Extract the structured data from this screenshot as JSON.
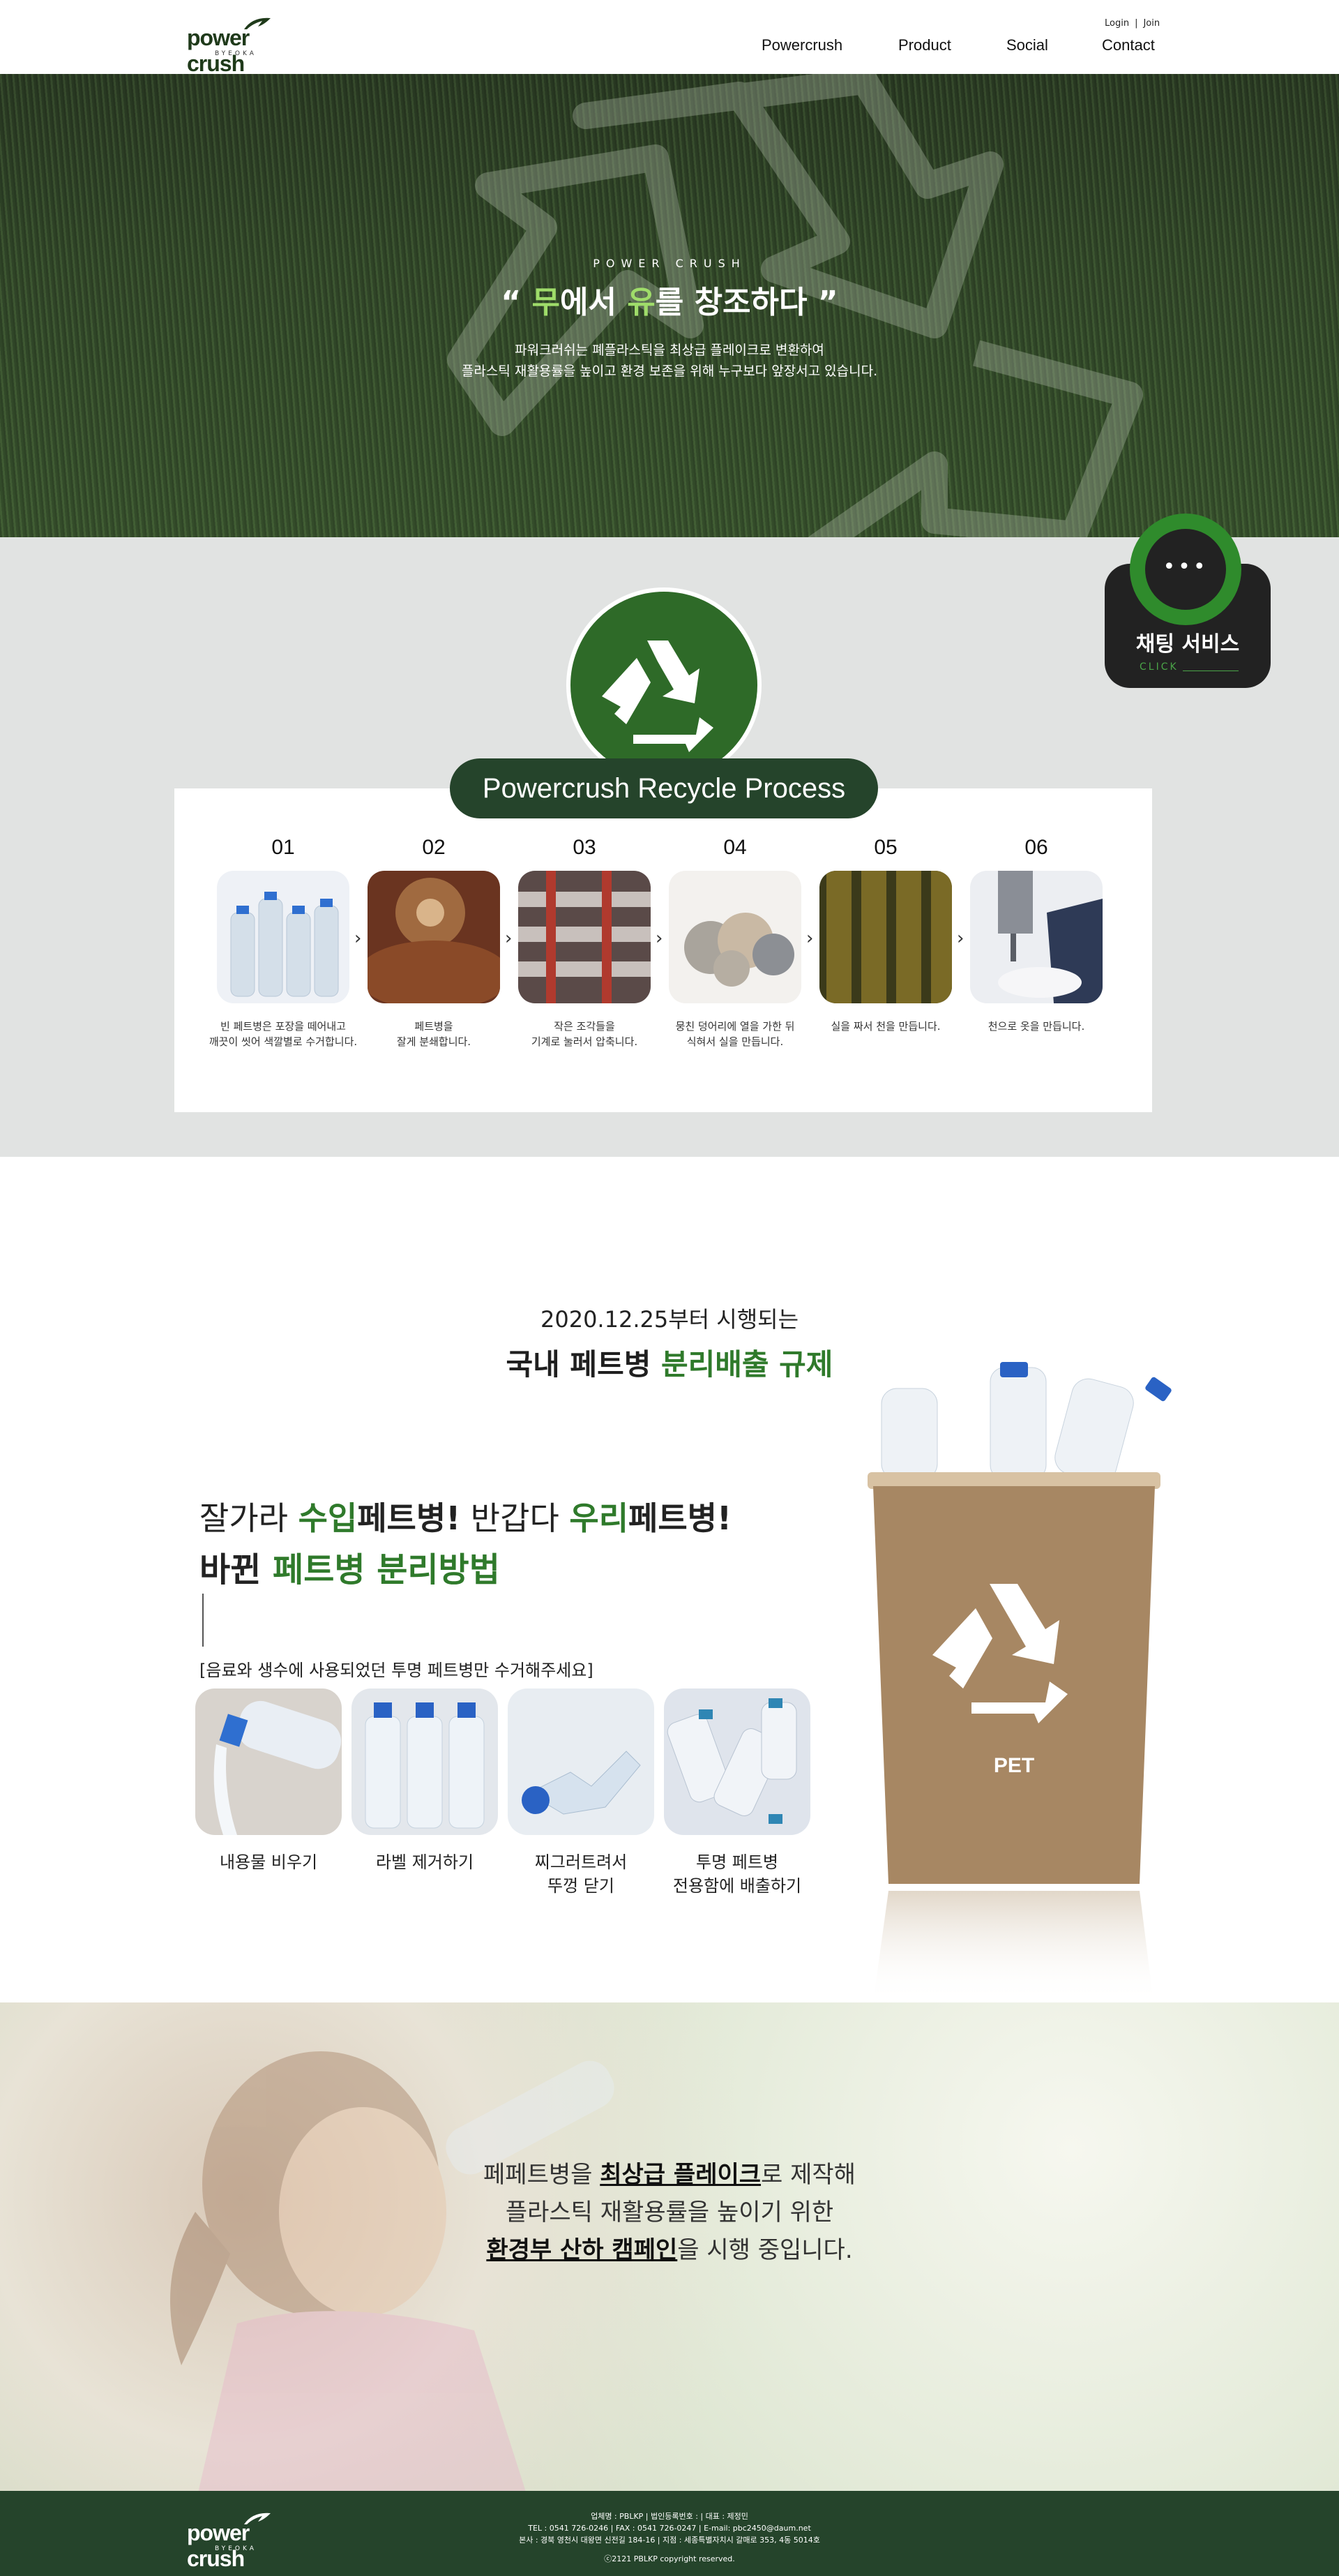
{
  "header": {
    "logo_text": "power crush",
    "logo_sub": "BYEOKA",
    "login": "Login",
    "divider": "|",
    "join": "Join",
    "nav": [
      "Powercrush",
      "Product",
      "Social",
      "Contact"
    ]
  },
  "hero": {
    "eyebrow": "POWER CRUSH",
    "title_open": "“ ",
    "title_g1": "무",
    "title_m1": "에서 ",
    "title_g2": "유",
    "title_m2": "를 창조하다",
    "title_close": " ”",
    "desc1": "파워크러쉬는 폐플라스틱을 최상급 플레이크로 변환하여",
    "desc2": "플라스틱 재활용률을 높이고 환경 보존을 위해 누구보다 앞장서고 있습니다."
  },
  "chat": {
    "dots": "•••",
    "label": "채팅 서비스",
    "click": "CLICK"
  },
  "process": {
    "title": "Powercrush  Recycle Process",
    "steps": [
      {
        "num": "01",
        "text1": "빈 페트병은 포장을 떼어내고",
        "text2": "깨끗이 씻어 색깔별로 수거합니다."
      },
      {
        "num": "02",
        "text1": "페트병을",
        "text2": "잘게 분쇄합니다."
      },
      {
        "num": "03",
        "text1": "작은 조각들을",
        "text2": "기계로 눌러서 압축니다."
      },
      {
        "num": "04",
        "text1": "뭉친 덩어리에 열을 가한 뒤",
        "text2": "식혀서 실을 만듭니다."
      },
      {
        "num": "05",
        "text1": "실을 짜서 천을 만듭니다.",
        "text2": ""
      },
      {
        "num": "06",
        "text1": "천으로 옷을 만듭니다.",
        "text2": ""
      }
    ]
  },
  "separation": {
    "h1": "2020.12.25부터 시행되는",
    "h2_pre": "국내 페트병 ",
    "h2_g": "분리배출 규제",
    "t1_a": "잘가라 ",
    "t1_g": "수입",
    "t1_b": "페트병!",
    "t1_c": "  반갑다 ",
    "t1_g2": "우리",
    "t1_d": "페트병!",
    "t2_a": "바뀐 ",
    "t2_g": "페트병 분리방법",
    "note": "[음료와 생수에 사용되었던 투명 페트병만 수거해주세요]",
    "tips": [
      {
        "l1": "내용물 비우기",
        "l2": ""
      },
      {
        "l1": "라벨 제거하기",
        "l2": ""
      },
      {
        "l1": "찌그러트려서",
        "l2": "뚜껑 닫기"
      },
      {
        "l1": "투명 페트병",
        "l2": "전용함에 배출하기"
      }
    ],
    "bin_label": "PET"
  },
  "campaign": {
    "l1_a": "페페트병을 ",
    "l1_u": "최상급 플레이크",
    "l1_b": "로 제작해",
    "l2": "플라스틱 재활용률을 높이기 위한",
    "l3_u": "환경부 산하 캠페인",
    "l3_b": "을 시행 중입니다."
  },
  "footer": {
    "logo_text": "power crush",
    "logo_sub": "BYEOKA",
    "line1": "업체명 : PBLKP    |    법인등록번호 :    |    대표 : 제정민",
    "line2": "TEL : 0541 726-0246    |    FAX : 0541 726-0247    |    E-mail: pbc2450@daum.net",
    "line3": "본사 : 경북 영천시 대왕면 신전길 184-16    |    지점 : 세종특별자치시 갈매로 353, 4동 5014호",
    "copy": "ⓒ2121 PBLKP copyright reserved."
  },
  "colors": {
    "brand_green": "#25442b",
    "accent_green": "#2f7a2b",
    "chat_green": "#2f8b2c",
    "bin_brown": "#a78763"
  }
}
